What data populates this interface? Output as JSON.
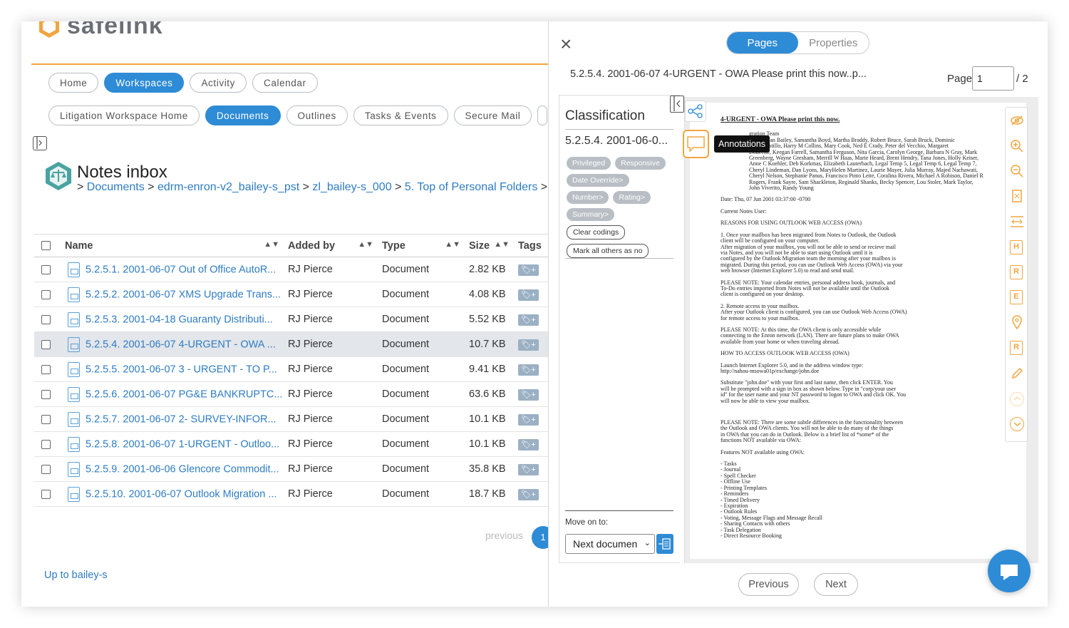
{
  "app": {
    "logo_text": "safelink"
  },
  "nav": {
    "main_tabs": [
      {
        "label": "Home",
        "active": false
      },
      {
        "label": "Workspaces",
        "active": true
      },
      {
        "label": "Activity",
        "active": false
      },
      {
        "label": "Calendar",
        "active": false
      }
    ],
    "sub_tabs": [
      {
        "label": "Litigation Workspace Home",
        "active": false
      },
      {
        "label": "Documents",
        "active": true
      },
      {
        "label": "Outlines",
        "active": false
      },
      {
        "label": "Tasks & Events",
        "active": false
      },
      {
        "label": "Secure Mail",
        "active": false
      }
    ]
  },
  "page": {
    "title": "Notes inbox",
    "breadcrumb": [
      "Documents",
      "edrm-enron-v2_bailey-s_pst",
      "zl_bailey-s_000",
      "5. Top of Personal Folders"
    ],
    "breadcrumb_sep": ">"
  },
  "table": {
    "headers": [
      "Name",
      "Added by",
      "Type",
      "Size",
      "Tags"
    ],
    "rows": [
      {
        "name": "5.2.5.1. 2001-06-07 Out of Office AutoR...",
        "added_by": "RJ Pierce",
        "type": "Document",
        "size": "2.82 KB",
        "selected": false
      },
      {
        "name": "5.2.5.2. 2001-06-07 XMS Upgrade Trans...",
        "added_by": "RJ Pierce",
        "type": "Document",
        "size": "4.08 KB",
        "selected": false
      },
      {
        "name": "5.2.5.3. 2001-04-18 Guaranty Distributi...",
        "added_by": "RJ Pierce",
        "type": "Document",
        "size": "5.52 KB",
        "selected": false
      },
      {
        "name": "5.2.5.4. 2001-06-07 4-URGENT - OWA ...",
        "added_by": "RJ Pierce",
        "type": "Document",
        "size": "10.7 KB",
        "selected": true
      },
      {
        "name": "5.2.5.5. 2001-06-07 3 - URGENT - TO P...",
        "added_by": "RJ Pierce",
        "type": "Document",
        "size": "9.41 KB",
        "selected": false
      },
      {
        "name": "5.2.5.6. 2001-06-07 PG&E BANKRUPTC...",
        "added_by": "RJ Pierce",
        "type": "Document",
        "size": "63.6 KB",
        "selected": false
      },
      {
        "name": "5.2.5.7. 2001-06-07 2- SURVEY-INFOR...",
        "added_by": "RJ Pierce",
        "type": "Document",
        "size": "10.1 KB",
        "selected": false
      },
      {
        "name": "5.2.5.8. 2001-06-07 1-URGENT - Outloo...",
        "added_by": "RJ Pierce",
        "type": "Document",
        "size": "10.1 KB",
        "selected": false
      },
      {
        "name": "5.2.5.9. 2001-06-06 Glencore Commodit...",
        "added_by": "RJ Pierce",
        "type": "Document",
        "size": "35.8 KB",
        "selected": false
      },
      {
        "name": "5.2.5.10. 2001-06-07 Outlook Migration ...",
        "added_by": "RJ Pierce",
        "type": "Document",
        "size": "18.7 KB",
        "selected": false
      }
    ],
    "tag_button": "+"
  },
  "pagination": {
    "previous": "previous",
    "current": "1"
  },
  "footer": {
    "up_link": "Up to bailey-s"
  },
  "viewer": {
    "close": "×",
    "tabs": [
      {
        "label": "Pages",
        "active": true
      },
      {
        "label": "Properties",
        "active": false
      }
    ],
    "doc_title": "5.2.5.4. 2001-06-07 4-URGENT - OWA Please print this now..p...",
    "page_label": "Page",
    "page_value": "1",
    "page_total": "/ 2",
    "tooltip": "Annotations",
    "prev_btn": "Previous",
    "next_btn": "Next"
  },
  "classification": {
    "title": "Classification",
    "doc_name": "5.2.5.4. 2001-06-0...",
    "chips": [
      "Privileged",
      "Responsive",
      "Date Override>",
      "Number>",
      "Rating>",
      "Summary>"
    ],
    "clear_btn": "Clear codings",
    "mark_btn": "Mark all others as no",
    "move_label": "Move on to:",
    "move_value": "Next documen"
  },
  "document": {
    "heading": "4-URGENT - OWA Please print this now.",
    "paragraphs": [
      "gration Team\nwitz, Susan Bailey, Samantha Boyd, Martha Braddy, Robert Bruce, Sarah Bruck, Dominic\nennie Castillo, Harry M Collins, Mary Cook, Ned E Crady, Peter del Vecchio, Margaret\nDoucette, Keegan Farrell, Samantha Ferguson, Nita Garcia, Carolyn George, Barbara N Gray, Mark\nGreenberg, Wayne Gresham, Merrill W Haas, Marie Heard, Brent Hendry, Tana Jones, Holly Keiser,\nAnne C Koehler, Deb Korkmas, Elizabeth Lauterbach, Legal Temp 5, Legal Temp 6, Legal Temp 7,\nCheryl Lindeman, Dan Lyons, MaryHelen Martinez, Laurie Mayer, Julia Murray, Majed Nachawati,\nCheryl Nelson, Stephanie Panus, Francisco Pinto Leite, Coralina Rivera, Michael A Robison, Daniel R\nRogers, Frank Sayre, Sam Shackleton, Reginald Shanks, Becky Spencer, Lou Stoler, Mark Taylor,\nJohn Viverito, Randy Young",
      "Date:          Thu, 07 Jun 2001 03:37:00 -0700",
      "Current Notes User:",
      "REASONS FOR USING OUTLOOK WEB ACCESS (OWA)",
      "1. Once your mailbox has been migrated from Notes to Outlook, the Outlook\nclient will be configured on your computer.\nAfter migration of your mailbox, you will not be able to send or recieve mail\nvia Notes, and you will not be able to start using Outlook until it is\nconfigured by the Outlook Migration team the morning after your mailbox is\nmigrated. During this period, you can use Outlook Web Access (OWA) via your\nweb browser (Internet Explorer 5.0) to read and send mail.",
      "PLEASE NOTE: Your calendar entries, personal address book, journals, and\nTo-Do entries imported from Notes will not be available until the Outlook\nclient is configured on your desktop.",
      "2. Remote access to your mailbox.\nAfter your Outlook client is configured, you can use Outlook Web Access (OWA)\nfor remote access to your mailbox.",
      "PLEASE NOTE: At this time, the OWA client is only accessible while\nconnecting to the Enron network (LAN). There are future plans to make OWA\navailable from your home or when traveling abroad.",
      "HOW TO ACCESS OUTLOOK WEB ACCESS (OWA)",
      "Launch Internet Explorer 5.0, and in the address window type:\nhttp://nahou-msowa01p/exchange/john.doe",
      "Substitute \"john.doe\" with your first and last name, then click ENTER. You\nwill be prompted with a sign in box as shown below. Type in \"corp/your user\nid\" for the user name and your NT password to logon to OWA and click OK. You\nwill now be able to view your mailbox.",
      "PLEASE NOTE: There are some subtle differences in the functionality between\nthe Outlook and OWA clients. You will not be able to do many of the things\nin OWA that you can do in Outlook. Below is a brief list of *some* of the\nfunctions NOT available via OWA:",
      "Features NOT available using OWA:",
      "- Tasks\n- Journal\n- Spell Checker\n- Offline Use\n- Printing Templates\n- Reminders\n- Timed Delivery\n- Expiration\n- Outlook Rules\n- Voting, Message Flags and Message Recall\n- Sharing Contacts with others\n- Task Delegation\n- Direct Resource Booking"
    ]
  },
  "tools": [
    "eye-off",
    "zoom-in",
    "zoom-out",
    "fit-page",
    "fit-width",
    "H",
    "R",
    "E",
    "pin",
    "R",
    "pencil",
    "chevron-up",
    "chevron-down"
  ],
  "colors": {
    "accent": "#2e8bd6",
    "highlight": "#f0a540",
    "link": "#2e7cc2"
  }
}
